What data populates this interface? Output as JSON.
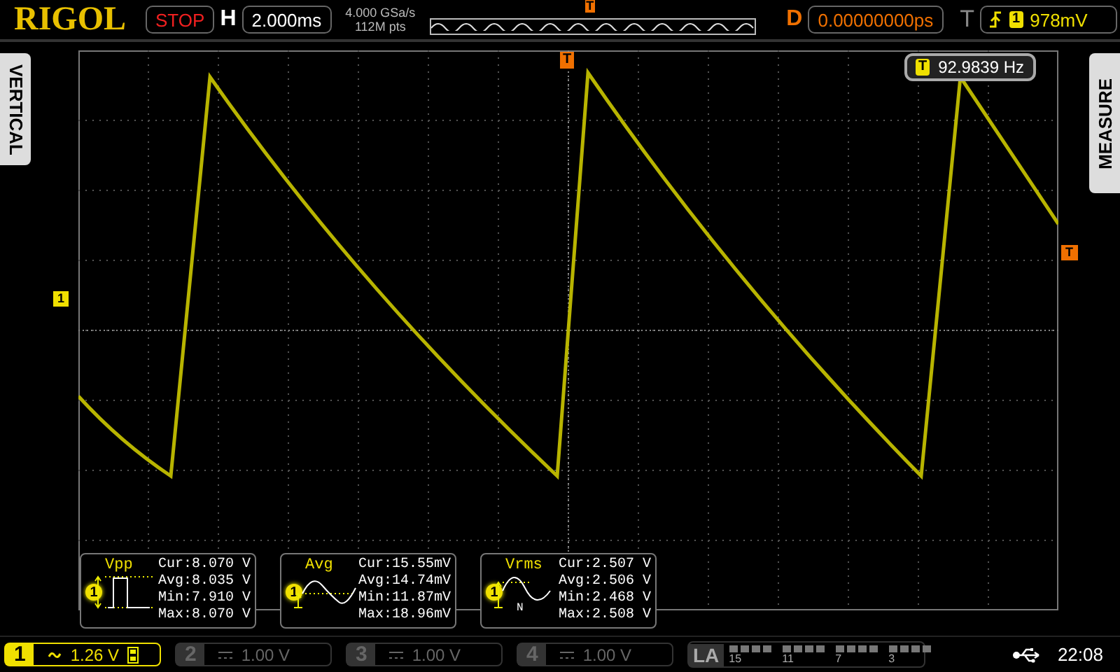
{
  "header": {
    "logo": "RIGOL",
    "run_state": "STOP",
    "timebase_label": "H",
    "timebase": "2.000ms",
    "sample_rate": "4.000 GSa/s",
    "memory_depth": "112M pts",
    "trigger_position_marker": "T",
    "delay_label": "D",
    "delay": "0.00000000ps",
    "trigger_label": "T",
    "trigger_channel": "1",
    "trigger_level": "978mV"
  },
  "side_tabs": {
    "left": "VERTICAL",
    "right": "MEASURE"
  },
  "plot": {
    "channel_marker": "1",
    "trigger_marker": "T",
    "trigger_level_marker": "T",
    "frequency_icon": "T",
    "frequency": "92.9839 Hz"
  },
  "measurements": [
    {
      "name": "Vpp",
      "kind": "pulse",
      "channel": "1",
      "rows": [
        "Cur:8.070 V",
        "Avg:8.035 V",
        "Min:7.910 V",
        "Max:8.070 V"
      ]
    },
    {
      "name": "Avg",
      "kind": "sine",
      "channel": "1",
      "rows": [
        "Cur:15.55mV",
        "Avg:14.74mV",
        "Min:11.87mV",
        "Max:18.96mV"
      ]
    },
    {
      "name": "Vrms",
      "kind": "sine-n",
      "channel": "1",
      "icon_label": "N",
      "rows": [
        "Cur:2.507 V",
        "Avg:2.506 V",
        "Min:2.468 V",
        "Max:2.508 V"
      ]
    }
  ],
  "channels": [
    {
      "label": "1",
      "kind": "ac",
      "scale": "1.26 V",
      "active": true
    },
    {
      "label": "2",
      "kind": "dc",
      "scale": "1.00 V",
      "active": false
    },
    {
      "label": "3",
      "kind": "dc",
      "scale": "1.00 V",
      "active": false
    },
    {
      "label": "4",
      "kind": "dc",
      "scale": "1.00 V",
      "active": false
    }
  ],
  "logic_analyzer": {
    "label": "LA",
    "bits": [
      "15",
      "11",
      "7",
      "3"
    ]
  },
  "status": {
    "time": "22:08"
  }
}
